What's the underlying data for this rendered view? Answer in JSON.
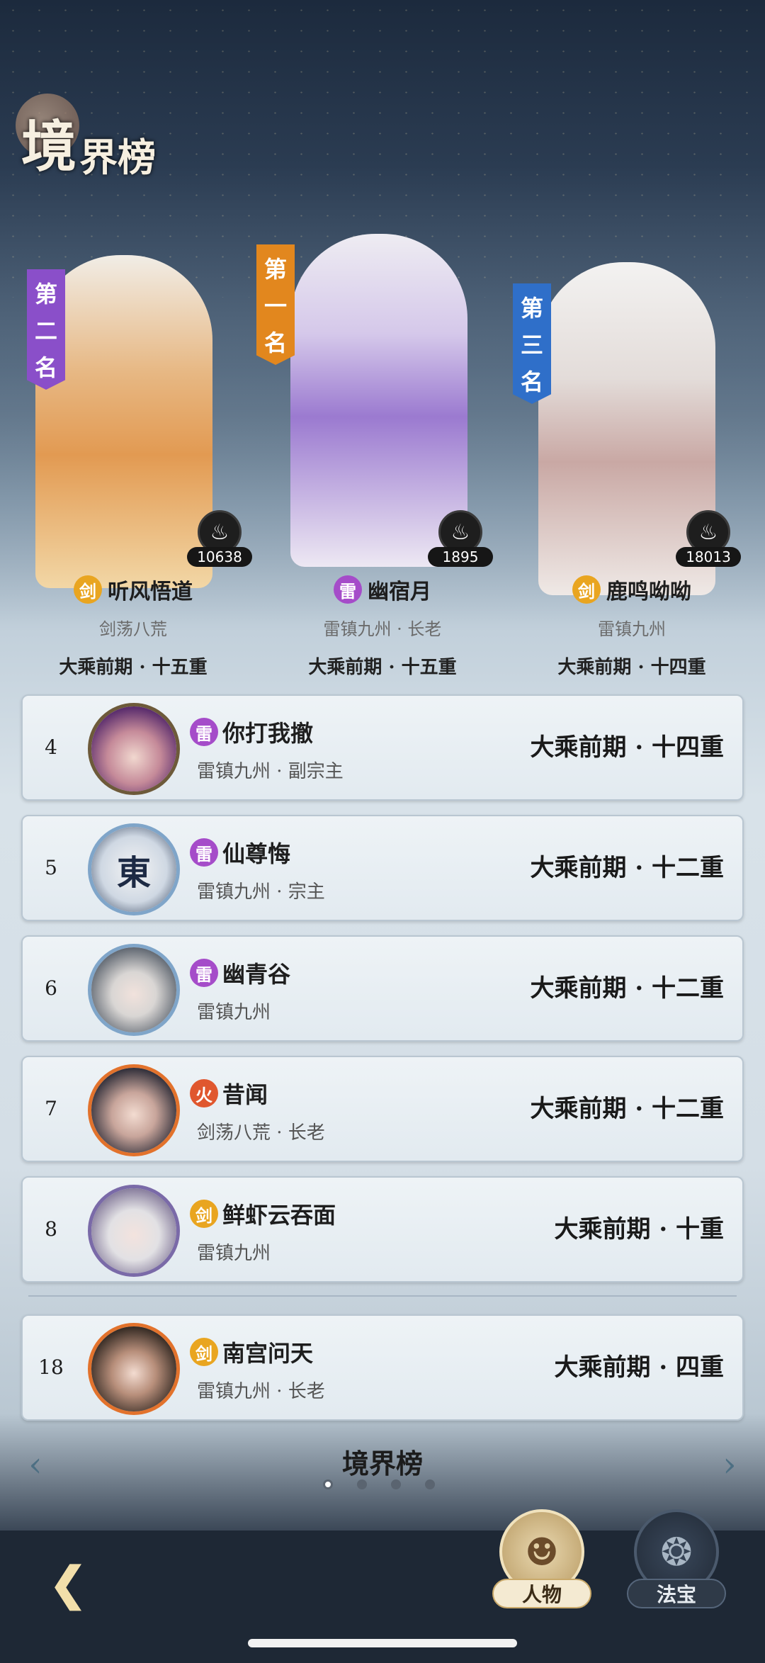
{
  "header": {
    "title_big": "境",
    "title_rest": "界榜"
  },
  "podium": [
    {
      "rank_label": [
        "第",
        "二",
        "名"
      ],
      "rank_color": "#8a4fc9",
      "badge_count": "10638",
      "element": "剑",
      "name": "听风悟道",
      "sub": "剑荡八荒",
      "realm": "大乘前期 · 十五重"
    },
    {
      "rank_label": [
        "第",
        "一",
        "名"
      ],
      "rank_color": "#e2871e",
      "badge_count": "1895",
      "element": "雷",
      "name": "幽宿月",
      "sub": "雷镇九州 · 长老",
      "realm": "大乘前期 · 十五重"
    },
    {
      "rank_label": [
        "第",
        "三",
        "名"
      ],
      "rank_color": "#2f6fc9",
      "badge_count": "18013",
      "element": "剑",
      "name": "鹿鸣呦呦",
      "sub": "雷镇九州",
      "realm": "大乘前期 · 十四重"
    }
  ],
  "list": [
    {
      "rank": "4",
      "element": "雷",
      "name": "你打我撤",
      "sub": "雷镇九州 · 副宗主",
      "realm": "大乘前期 · 十四重"
    },
    {
      "rank": "5",
      "element": "雷",
      "name": "仙尊悔",
      "sub": "雷镇九州 · 宗主",
      "realm": "大乘前期 · 十二重",
      "avatar_glyph": "東"
    },
    {
      "rank": "6",
      "element": "雷",
      "name": "幽青谷",
      "sub": "雷镇九州",
      "realm": "大乘前期 · 十二重"
    },
    {
      "rank": "7",
      "element": "火",
      "name": "昔闻",
      "sub": "剑荡八荒 · 长老",
      "realm": "大乘前期 · 十二重"
    },
    {
      "rank": "8",
      "element": "剑",
      "name": "鲜虾云吞面",
      "sub": "雷镇九州",
      "realm": "大乘前期 · 十重"
    },
    {
      "rank": "18",
      "element": "剑",
      "name": "南宫问天",
      "sub": "雷镇九州 · 长老",
      "realm": "大乘前期 · 四重"
    }
  ],
  "footer": {
    "title": "境界榜"
  },
  "tabs": {
    "person": "人物",
    "treasure": "法宝"
  },
  "colors": {
    "jian": "#e9a520",
    "lei": "#a54cc9",
    "huo": "#e0572e"
  }
}
